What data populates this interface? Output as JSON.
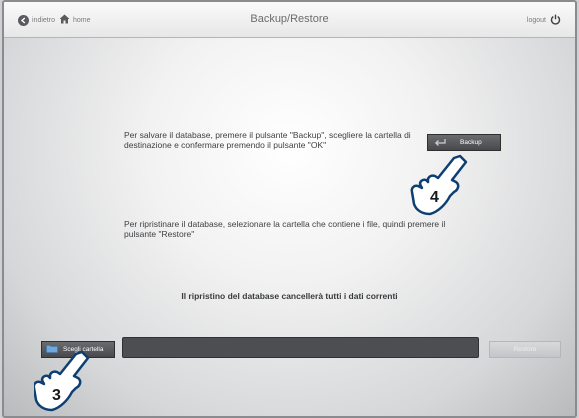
{
  "header": {
    "back_label": "indietro",
    "home_label": "home",
    "title": "Backup/Restore",
    "logout_label": "logout"
  },
  "main": {
    "backup_instruction": "Per salvare il database, premere il pulsante \"Backup\", scegliere la cartella di destinazione e confermare premendo il pulsante \"OK\"",
    "backup_button_label": "Backup",
    "restore_instruction": "Per ripristinare il database, selezionare la cartella che contiene i file, quindi premere il pulsante \"Restore\"",
    "warning": "Il ripristino del database cancellerà tutti i dati correnti"
  },
  "footer": {
    "choose_folder_label": "Scegli cartella",
    "path_value": "",
    "restore_button_label": "Restore"
  },
  "callouts": {
    "step_backup": "4",
    "step_choose_folder": "3"
  },
  "icons": {
    "back": "arrow-left-icon",
    "home": "home-icon",
    "logout": "power-icon",
    "backup": "return-arrow-icon",
    "folder": "folder-icon",
    "pointer": "hand-pointer-icon"
  }
}
